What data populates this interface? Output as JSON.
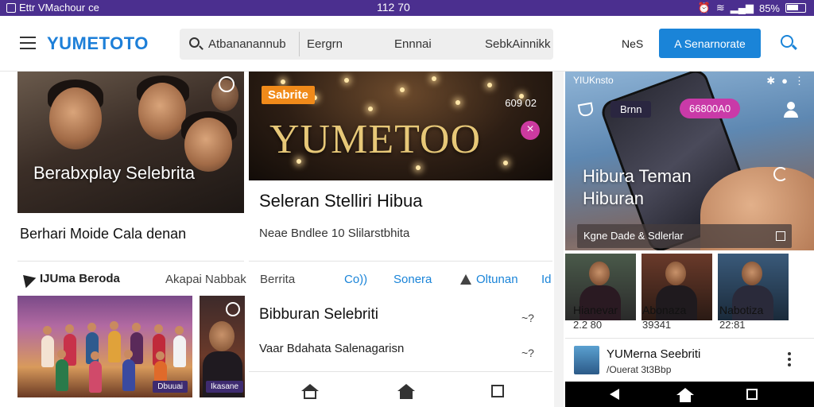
{
  "status_bar": {
    "app_name": "Ettr VMachour",
    "app_suffix": "ce",
    "time": "112 70",
    "battery": "85%"
  },
  "app_bar": {
    "logo": "YUMETOTO",
    "search_query": "Atbananannub",
    "filters": [
      "Eergrn",
      "Ennnai",
      "SebkAinnikk"
    ],
    "link": "NeS",
    "cta_label": "A Senarnorate",
    "accent_color": "#1a84d8",
    "status_color": "#4b2f8f"
  },
  "left_column": {
    "card": {
      "caption": "Berabxplay Selebrita",
      "title": "Berhari Moide Cala denan"
    },
    "section": {
      "title": "IJUma Beroda",
      "link": "Akapai Nabbak"
    },
    "thumb_badge": "Dbuuai",
    "thumb2_badge": "Ikasane"
  },
  "middle_column": {
    "hero": {
      "tag": "Sabrite",
      "big_text": "YUMETOO",
      "counter": "609 02"
    },
    "title": "Seleran Stelliri Hibua",
    "subtitle": "Neae Bndlee 10 Slilarstbhita",
    "tabs": [
      "Berrita",
      "Co))",
      "Sonera",
      "Oltunan",
      "Id"
    ],
    "rows": [
      {
        "label": "Bibburan Selebriti",
        "count": "~?"
      },
      {
        "label": "Vaar Bdahata Salenagarisn",
        "count": "~?"
      }
    ]
  },
  "right_column": {
    "top_label": "YIUKnsto",
    "pill_left": "Brnn",
    "pill_right": "66800A0",
    "title": "Hibura Teman Hiburan",
    "strip": "Kgne Dade & Sdlerlar",
    "people": [
      {
        "name": "Hianevar",
        "count": "2.2 80"
      },
      {
        "name": "Abonaza",
        "count": "39341"
      },
      {
        "name": "Nabotiza",
        "count": "22:81"
      }
    ],
    "item": {
      "title": "YUMerna Seebriti",
      "subtitle": "/Ouerat 3t3Bbp"
    }
  }
}
